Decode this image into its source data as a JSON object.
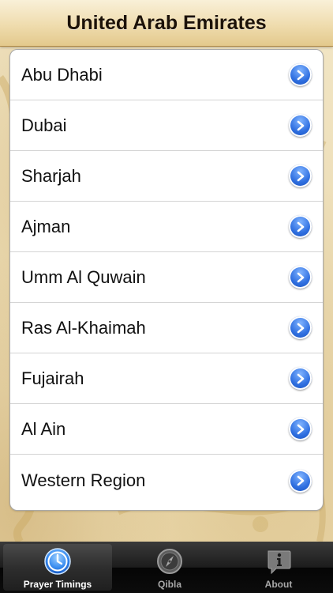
{
  "header": {
    "title": "United Arab Emirates"
  },
  "emirates": [
    {
      "label": "Abu Dhabi",
      "icon": "chevron-right-circle-icon"
    },
    {
      "label": "Dubai",
      "icon": "chevron-right-circle-icon"
    },
    {
      "label": "Sharjah",
      "icon": "chevron-right-circle-icon"
    },
    {
      "label": "Ajman",
      "icon": "chevron-right-circle-icon"
    },
    {
      "label": "Umm Al Quwain",
      "icon": "chevron-right-circle-icon"
    },
    {
      "label": "Ras Al-Khaimah",
      "icon": "chevron-right-circle-icon"
    },
    {
      "label": "Fujairah",
      "icon": "chevron-right-circle-icon"
    },
    {
      "label": "Al Ain",
      "icon": "chevron-right-circle-icon"
    },
    {
      "label": "Western Region",
      "icon": "chevron-right-circle-icon"
    }
  ],
  "tabbar": {
    "tabs": [
      {
        "label": "Prayer Timings",
        "icon": "clock-icon",
        "active": true
      },
      {
        "label": "Qibla",
        "icon": "compass-icon",
        "active": false
      },
      {
        "label": "About",
        "icon": "info-icon",
        "active": false
      }
    ]
  },
  "colors": {
    "accent_blue": "#2f6fe0",
    "parchment": "#ecdcb4",
    "tabbar_dark": "#1c1c1c"
  }
}
